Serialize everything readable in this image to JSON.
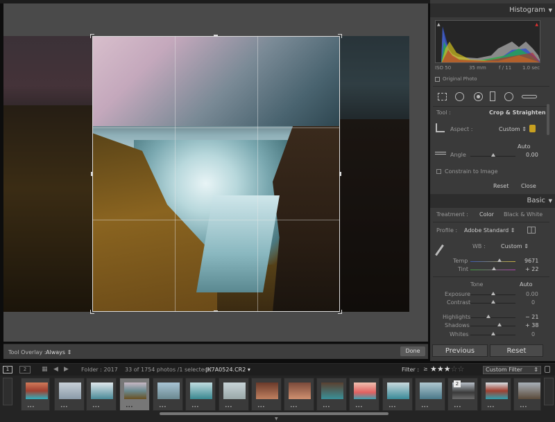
{
  "panel": {
    "histogram_title": "Histogram",
    "iso": "ISO 50",
    "focal": "35 mm",
    "aperture": "f / 11",
    "shutter": "1.0 sec",
    "original_photo": "Original Photo",
    "tool_label": "Tool :",
    "tool_value": "Crop & Straighten",
    "aspect_label": "Aspect :",
    "aspect_value": "Custom",
    "auto_label": "Auto",
    "angle_label": "Angle",
    "angle_value": "0.00",
    "angle_level": 0.5,
    "constrain_label": "Constrain to Image",
    "reset_label": "Reset",
    "close_label": "Close",
    "basic_title": "Basic",
    "treatment_label": "Treatment :",
    "treatment_color": "Color",
    "treatment_bw": "Black & White",
    "profile_label": "Profile :",
    "profile_value": "Adobe Standard",
    "wb_label": "WB :",
    "wb_value": "Custom",
    "temp_label": "Temp",
    "temp_value": "9671",
    "tint_label": "Tint",
    "tint_value": "+ 22",
    "tone_label": "Tone",
    "tone_auto": "Auto",
    "exposure_label": "Exposure",
    "exposure_value": "0.00",
    "contrast_label": "Contrast",
    "contrast_value": "0",
    "highlights_label": "Highlights",
    "highlights_value": "− 21",
    "shadows_label": "Shadows",
    "shadows_value": "+ 38",
    "whites_label": "Whites",
    "whites_value": "0",
    "previous_label": "Previous",
    "reset_big_label": "Reset"
  },
  "toolbar": {
    "overlay_label": "Tool Overlay :",
    "overlay_value": "Always",
    "done_label": "Done"
  },
  "filmbar": {
    "view1": "1",
    "view2": "2",
    "folder": "Folder : 2017",
    "count": "33 of 1754 photos /1 selected /",
    "filename": "JK7A0524.CR2",
    "filter_label": "Filter :",
    "filter_value": "Custom Filter"
  },
  "thumb_badge": "2",
  "colors": {
    "accent": "#3a3a3a",
    "panel_head": "#2d2d2d"
  }
}
